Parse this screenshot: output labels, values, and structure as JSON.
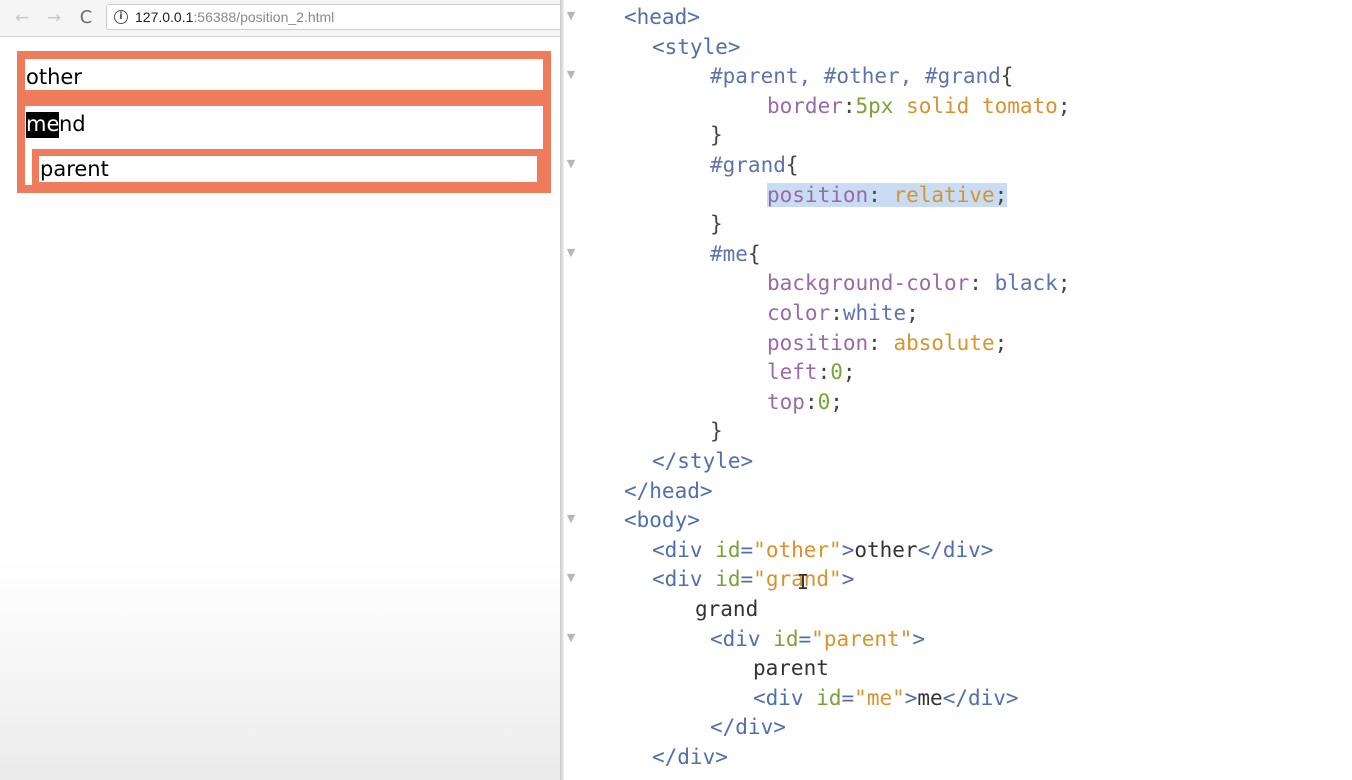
{
  "browser": {
    "url_host": "127.0.0.1",
    "url_path": ":56388/position_2.html",
    "back_icon": "←",
    "forward_icon": "→",
    "reload_icon": "C",
    "info_icon": "i"
  },
  "page": {
    "other_text": "other",
    "grand_text": "nd",
    "me_text": "me",
    "parent_text": "parent"
  },
  "colors": {
    "border": "#ef7b5d",
    "highlight": "#c8ddf4"
  },
  "code": {
    "lines": [
      {
        "parts": [
          [
            "tag",
            "<head>"
          ]
        ]
      },
      {
        "parts": [
          [
            "tag",
            "<style>"
          ]
        ]
      },
      {
        "parts": [
          [
            "sel",
            "#parent, #other, #grand"
          ],
          [
            "brace",
            "{"
          ]
        ]
      },
      {
        "parts": [
          [
            "prop",
            "border"
          ],
          [
            "brace",
            ":"
          ],
          [
            "num",
            "5px "
          ],
          [
            "val",
            "solid tomato"
          ],
          [
            "brace",
            ";"
          ]
        ]
      },
      {
        "parts": [
          [
            "brace",
            "}"
          ]
        ]
      },
      {
        "parts": [
          [
            "sel",
            "#grand"
          ],
          [
            "brace",
            "{"
          ]
        ]
      },
      {
        "parts": [
          [
            "prop",
            "position"
          ],
          [
            "brace",
            ": "
          ],
          [
            "val",
            "relative"
          ],
          [
            "brace",
            ";"
          ]
        ],
        "highlight": true
      },
      {
        "parts": [
          [
            "brace",
            "}"
          ]
        ]
      },
      {
        "parts": [
          [
            "sel",
            "#me"
          ],
          [
            "brace",
            "{"
          ]
        ]
      },
      {
        "parts": [
          [
            "prop",
            "background-color"
          ],
          [
            "brace",
            ": "
          ],
          [
            "sel",
            "black"
          ],
          [
            "brace",
            ";"
          ]
        ]
      },
      {
        "parts": [
          [
            "prop",
            "color"
          ],
          [
            "brace",
            ":"
          ],
          [
            "sel",
            "white"
          ],
          [
            "brace",
            ";"
          ]
        ]
      },
      {
        "parts": [
          [
            "prop",
            "position"
          ],
          [
            "brace",
            ": "
          ],
          [
            "val",
            "absolute"
          ],
          [
            "brace",
            ";"
          ]
        ]
      },
      {
        "parts": [
          [
            "prop",
            "left"
          ],
          [
            "brace",
            ":"
          ],
          [
            "num",
            "0"
          ],
          [
            "brace",
            ";"
          ]
        ]
      },
      {
        "parts": [
          [
            "prop",
            "top"
          ],
          [
            "brace",
            ":"
          ],
          [
            "num",
            "0"
          ],
          [
            "brace",
            ";"
          ]
        ]
      },
      {
        "parts": [
          [
            "brace",
            "}"
          ]
        ]
      },
      {
        "parts": [
          [
            "tag",
            "</style>"
          ]
        ]
      },
      {
        "parts": [
          [
            "tag",
            "</head>"
          ]
        ]
      },
      {
        "parts": [
          [
            "tag",
            "<body>"
          ]
        ]
      },
      {
        "parts": [
          [
            "tag",
            "<div "
          ],
          [
            "attr",
            "id"
          ],
          [
            "tag",
            "="
          ],
          [
            "str",
            "\"other\""
          ],
          [
            "tag",
            ">"
          ],
          [
            "txt",
            "other"
          ],
          [
            "tag",
            "</div>"
          ]
        ]
      },
      {
        "parts": [
          [
            "tag",
            "<div "
          ],
          [
            "attr",
            "id"
          ],
          [
            "tag",
            "="
          ],
          [
            "str",
            "\"grand\""
          ],
          [
            "tag",
            ">"
          ]
        ]
      },
      {
        "parts": [
          [
            "txt",
            "grand"
          ]
        ]
      },
      {
        "parts": [
          [
            "tag",
            "<div "
          ],
          [
            "attr",
            "id"
          ],
          [
            "tag",
            "="
          ],
          [
            "str",
            "\"parent\""
          ],
          [
            "tag",
            ">"
          ]
        ]
      },
      {
        "parts": [
          [
            "txt",
            "parent"
          ]
        ]
      },
      {
        "parts": [
          [
            "tag",
            "<div "
          ],
          [
            "attr",
            "id"
          ],
          [
            "tag",
            "="
          ],
          [
            "str",
            "\"me\""
          ],
          [
            "tag",
            ">"
          ],
          [
            "txt",
            "me"
          ],
          [
            "tag",
            "</div>"
          ]
        ]
      },
      {
        "parts": [
          [
            "tag",
            "</div>"
          ]
        ]
      },
      {
        "parts": [
          [
            "tag",
            "</div>"
          ]
        ]
      }
    ]
  }
}
